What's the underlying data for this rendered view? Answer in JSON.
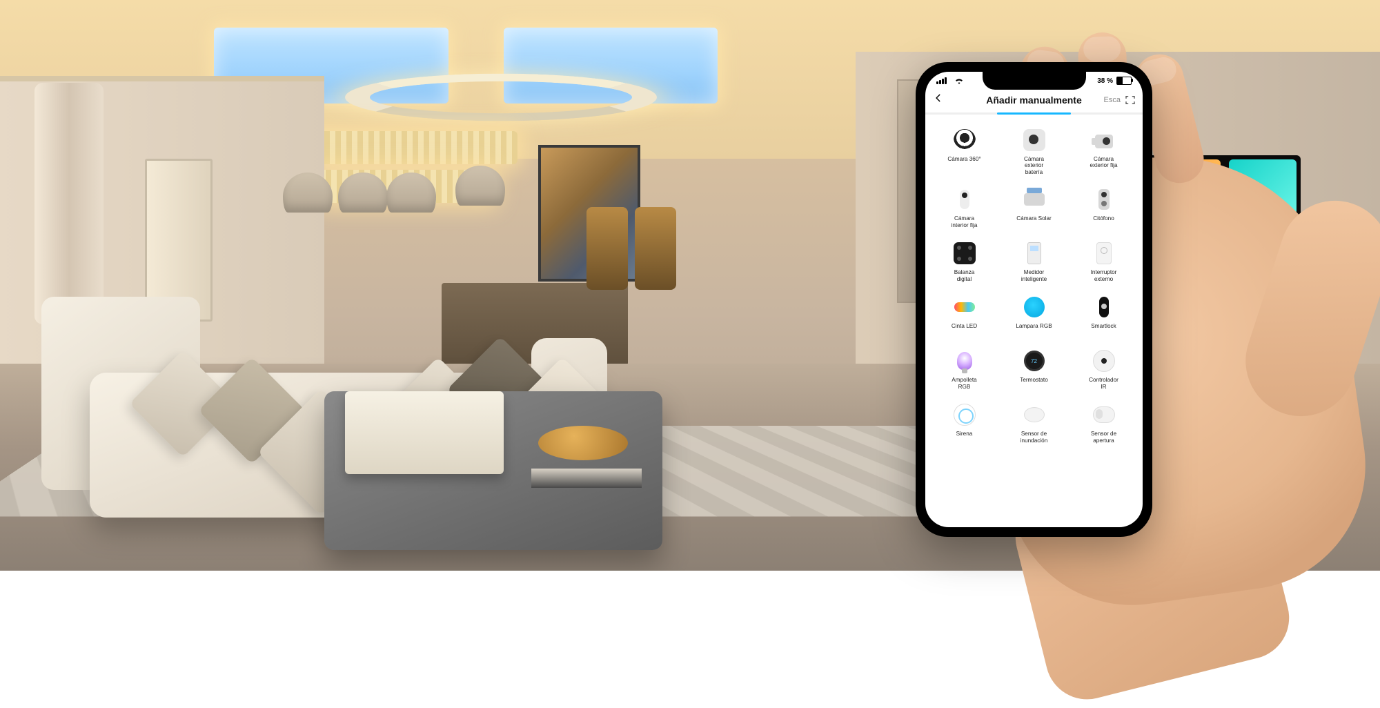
{
  "status_bar": {
    "signal_glyph": "▮▮▮▮",
    "wifi_glyph": "⧋",
    "battery_text": "38 %"
  },
  "header": {
    "title": "Añadir manualmente",
    "back_icon": "chevron-left",
    "scan_label": "Esca",
    "scan_icon": "scan"
  },
  "devices": [
    {
      "id": "camara-360",
      "label": "Cámara 360°",
      "icon": "ic-cam360"
    },
    {
      "id": "camara-ext-bateria",
      "label": "Cámara\nexterior\nbatería",
      "icon": "ic-camext"
    },
    {
      "id": "camara-ext-fija",
      "label": "Cámara\nexterior fija",
      "icon": "ic-camfix"
    },
    {
      "id": "camara-int-fija",
      "label": "Cámara\ninterior fija",
      "icon": "ic-camint"
    },
    {
      "id": "camara-solar",
      "label": "Cámara Solar",
      "icon": "ic-camsolar"
    },
    {
      "id": "citofono",
      "label": "Citófono",
      "icon": "ic-doorbell"
    },
    {
      "id": "balanza-digital",
      "label": "Balanza\ndigital",
      "icon": "ic-scale"
    },
    {
      "id": "medidor-inteligente",
      "label": "Medidor\ninteligente",
      "icon": "ic-meter"
    },
    {
      "id": "interruptor-externo",
      "label": "Interruptor\nexterno",
      "icon": "ic-switch"
    },
    {
      "id": "cinta-led",
      "label": "Cinta LED",
      "icon": "ic-strip"
    },
    {
      "id": "lampara-rgb",
      "label": "Lampara RGB",
      "icon": "ic-lamp"
    },
    {
      "id": "smartlock",
      "label": "Smartlock",
      "icon": "ic-lock"
    },
    {
      "id": "ampolleta-rgb",
      "label": "Ampolleta\nRGB",
      "icon": "ic-bulb"
    },
    {
      "id": "termostato",
      "label": "Termostato",
      "icon": "ic-thermo"
    },
    {
      "id": "controlador-ir",
      "label": "Controlador\nIR",
      "icon": "ic-ir"
    },
    {
      "id": "sirena",
      "label": "Sirena",
      "icon": "ic-siren"
    },
    {
      "id": "sensor-inundacion",
      "label": "Sensor de\ninundación",
      "icon": "ic-flood"
    },
    {
      "id": "sensor-apertura",
      "label": "Sensor de\napertura",
      "icon": "ic-contact"
    }
  ]
}
